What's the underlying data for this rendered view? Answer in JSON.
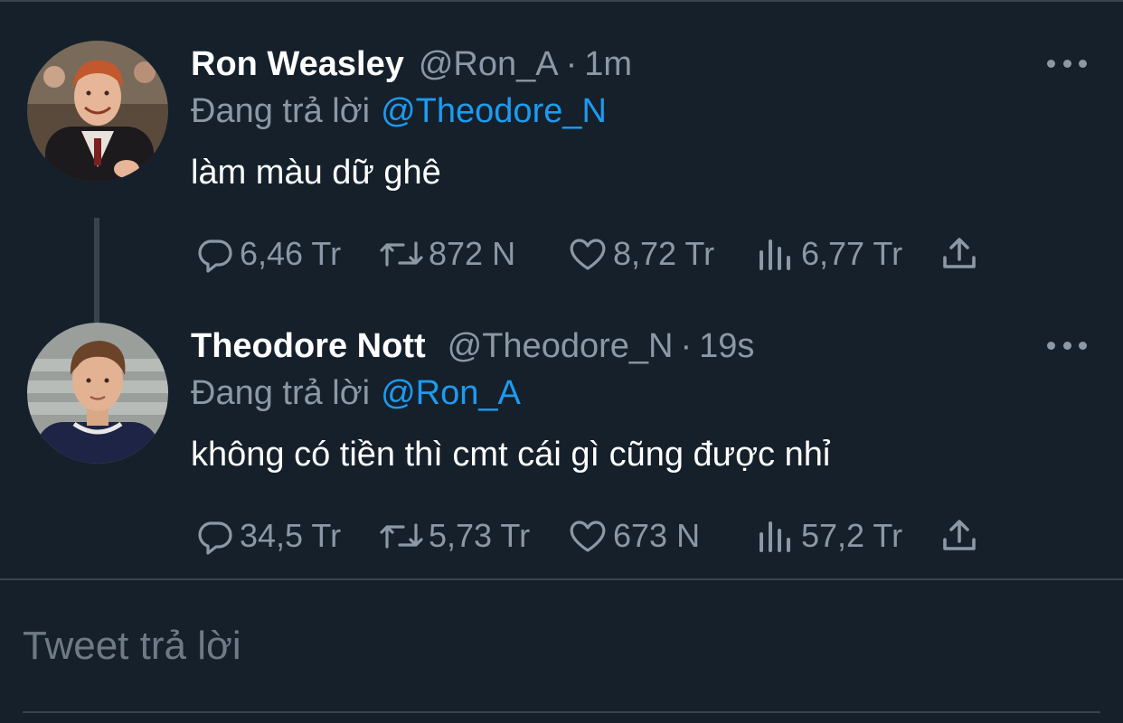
{
  "tweets": [
    {
      "name": "Ron Weasley",
      "handle": "@Ron_A",
      "dot": "·",
      "time": "1m",
      "reply_prefix": "Đang trả lời",
      "reply_to": "@Theodore_N",
      "text": "làm màu dữ ghê",
      "replies": "6,46 Tr",
      "retweets": "872 N",
      "likes": "8,72 Tr",
      "views": "6,77 Tr",
      "icons": [
        "reply-icon",
        "retweet-icon",
        "like-icon",
        "views-icon",
        "share-icon",
        "more-icon"
      ]
    },
    {
      "name": "Theodore Nott",
      "handle": "@Theodore_N",
      "dot": "·",
      "time": "19s",
      "reply_prefix": "Đang trả lời",
      "reply_to": "@Ron_A",
      "text": "không có tiền thì cmt cái gì cũng được nhỉ",
      "replies": "34,5 Tr",
      "retweets": "5,73 Tr",
      "likes": "673 N",
      "views": "57,2 Tr",
      "icons": [
        "reply-icon",
        "retweet-icon",
        "like-icon",
        "views-icon",
        "share-icon",
        "more-icon"
      ]
    }
  ],
  "compose": {
    "placeholder": "Tweet trả lời"
  },
  "colors": {
    "background": "#15202b",
    "divider": "#38444d",
    "secondary_text": "#8b98a5",
    "mention": "#1d9bf0",
    "primary_text": "#ffffff"
  }
}
